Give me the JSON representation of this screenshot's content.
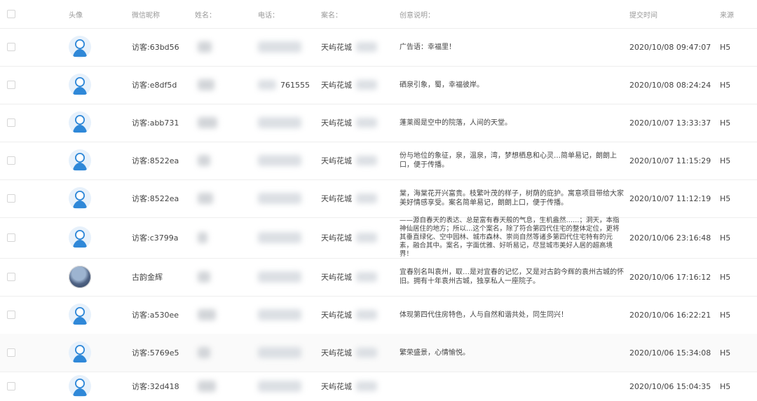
{
  "header": {
    "avatar": "头像",
    "nickname": "微信昵称",
    "name": "姓名：",
    "phone": "电话：",
    "project": "案名：",
    "idea": "创意说明：",
    "time": "提交时间",
    "source": "来源"
  },
  "rows": [
    {
      "nickname": "访客:63bd56",
      "project": "天屿花城",
      "idea": "广告语：幸福里！",
      "time": "2020/10/08 09:47:07",
      "source": "H5",
      "phone_visible": ""
    },
    {
      "nickname": "访客:e8df5d",
      "project": "天屿花城",
      "idea": "硒泉引象，蜀，幸福彼岸。",
      "time": "2020/10/08 08:24:24",
      "source": "H5",
      "phone_visible": "761555"
    },
    {
      "nickname": "访客:abb731",
      "project": "天屿花城",
      "idea": "蓬莱阁是空中的院落，人间的天堂。",
      "time": "2020/10/07 13:33:37",
      "source": "H5",
      "phone_visible": ""
    },
    {
      "nickname": "访客:8522ea",
      "project": "天屿花城",
      "idea": "份与地位的象征，泉，温泉，湾，梦想栖息和心灵…简单易记，朗朗上口，便于传播。",
      "time": "2020/10/07 11:15:29",
      "source": "H5",
      "phone_visible": ""
    },
    {
      "nickname": "访客:8522ea",
      "project": "天屿花城",
      "idea": "棠，海棠花开兴富贵。枝繁叶茂的样子，树荫的庇护。寓意项目带给大家美好情感享受。案名简单易记，朗朗上口，便于传播。",
      "time": "2020/10/07 11:12:19",
      "source": "H5",
      "phone_visible": ""
    },
    {
      "nickname": "访客:c3799a",
      "project": "天屿花城",
      "idea": "——源自春天的表达、总是富有春天般的气息，生机盎然……；洞天，本指神仙居住的地方；所以…这个案名，除了符合第四代住宅的整体定位，更将其垂直绿化、空中园林、城市森林、崇尚自然等诸多第四代住宅特有的元素，融合其中。案名，字面优雅、好听易记，尽显城市美好人居的超高境界！",
      "time": "2020/10/06 23:16:48",
      "source": "H5",
      "phone_visible": ""
    },
    {
      "nickname": "古韵金辉",
      "project": "天屿花城",
      "idea": "宜春别名叫袁州，取…是对宜春的记忆，又是对古韵今辉的袁州古城的怀旧。拥有十年袁州古城，独享私人一座院子。",
      "time": "2020/10/06 17:16:12",
      "source": "H5",
      "phone_visible": ""
    },
    {
      "nickname": "访客:a530ee",
      "project": "天屿花城",
      "idea": "体现第四代住房特色，人与自然和谐共处，同生同兴！",
      "time": "2020/10/06 16:22:21",
      "source": "H5",
      "phone_visible": ""
    },
    {
      "nickname": "访客:5769e5",
      "project": "天屿花城",
      "idea": "繁荣盛景，心情愉悦。",
      "time": "2020/10/06 15:34:08",
      "source": "H5",
      "phone_visible": ""
    },
    {
      "nickname": "访客:32d418",
      "project": "天屿花城",
      "idea": "",
      "time": "2020/10/06 15:04:35",
      "source": "H5",
      "phone_visible": ""
    }
  ]
}
